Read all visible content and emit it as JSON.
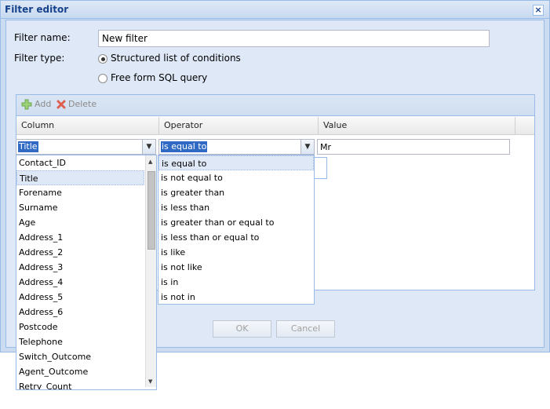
{
  "window": {
    "title": "Filter editor",
    "close_icon": "×"
  },
  "form": {
    "filter_name_label": "Filter name:",
    "filter_name_value": "New filter",
    "filter_type_label": "Filter type:",
    "radio_structured": "Structured list of conditions",
    "radio_sql": "Free form SQL query"
  },
  "toolbar": {
    "add_label": "Add",
    "delete_label": "Delete"
  },
  "grid": {
    "columns": [
      "Column",
      "Operator",
      "Value"
    ],
    "row": {
      "column": "Title",
      "operator": "is equal to",
      "value": "Mr"
    }
  },
  "column_options": [
    "Contact_ID",
    "Title",
    "Forename",
    "Surname",
    "Age",
    "Address_1",
    "Address_2",
    "Address_3",
    "Address_4",
    "Address_5",
    "Address_6",
    "Postcode",
    "Telephone",
    "Switch_Outcome",
    "Agent_Outcome",
    "Retry_Count"
  ],
  "operator_options": [
    "is equal to",
    "is not equal to",
    "is greater than",
    "is less than",
    "is greater than or equal to",
    "is less than or equal to",
    "is like",
    "is not like",
    "is in",
    "is not in"
  ],
  "buttons": {
    "ok": "OK",
    "cancel": "Cancel"
  }
}
